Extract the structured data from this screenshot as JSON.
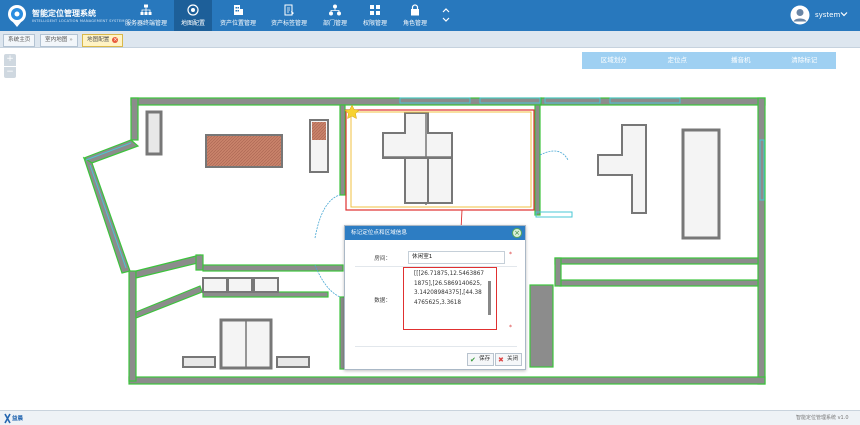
{
  "app": {
    "title": "智能定位管理系统",
    "subtitle": "INTELLIGENT LOCATION MANAGEMENT SYSTEM"
  },
  "nav": {
    "items": [
      {
        "label": "服务器终端管理",
        "icon": "sitemap-icon"
      },
      {
        "label": "地图配置",
        "icon": "map-target-icon"
      },
      {
        "label": "资产位置管理",
        "icon": "building-icon"
      },
      {
        "label": "资产标签管理",
        "icon": "tag-document-icon"
      },
      {
        "label": "部门管理",
        "icon": "org-chart-icon"
      },
      {
        "label": "权限管理",
        "icon": "grid-icon"
      },
      {
        "label": "角色管理",
        "icon": "lock-icon"
      }
    ],
    "more_icon": "double-chevron-icon"
  },
  "user": {
    "name": "system",
    "avatar_icon": "user-avatar-icon"
  },
  "tabs": [
    {
      "label": "系统主页"
    },
    {
      "label": "室内地图"
    },
    {
      "label": "地图配置"
    }
  ],
  "zoom": {
    "in_label": "+",
    "out_label": "−"
  },
  "toolbar": {
    "items": [
      "区域划分",
      "定位点",
      "播音机",
      "清除标记"
    ]
  },
  "dialog": {
    "title": "标记定位点和区域信息",
    "name_label": "房间：",
    "name_value": "休闲室1",
    "data_label": "数据：",
    "data_value": "[[[26.71875,12.54638671875],[26.5869140625,3.14208984375],[44.384765625,3.3618",
    "required_mark": "*",
    "save_label": "保存",
    "close_label": "关闭"
  },
  "footer": {
    "brand": "益晨",
    "text": "智能定位管理系统 v1.0"
  },
  "colors": {
    "header_bg": "#2878bd",
    "wall_outline": "#3cc43c",
    "wall_fill": "#8c8c8c",
    "cyan_outline": "#49c7d4",
    "region_red": "#e03030",
    "region_yellow": "#f0c040",
    "toolbar_bg": "#9fd0f2"
  }
}
